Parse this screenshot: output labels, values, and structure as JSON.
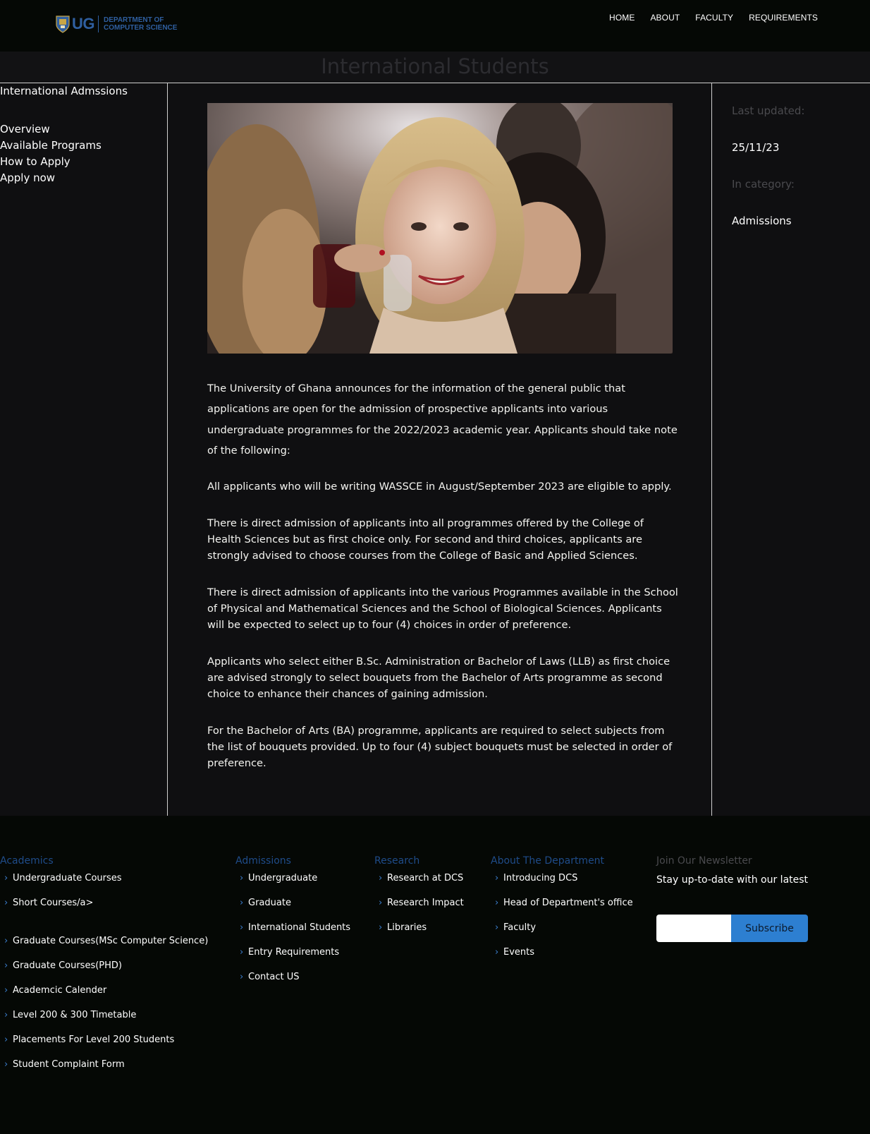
{
  "header": {
    "logo_abbrev": "UG",
    "logo_dept_line1": "DEPARTMENT OF",
    "logo_dept_line2": "COMPUTER SCIENCE",
    "nav": [
      {
        "label": "HOME"
      },
      {
        "label": "ABOUT"
      },
      {
        "label": "FACULTY"
      },
      {
        "label": "REQUIREMENTS"
      }
    ]
  },
  "page_title": "International Students",
  "sidebar": {
    "title": "International Admssions",
    "items": [
      {
        "label": "Overview"
      },
      {
        "label": "Available Programs"
      },
      {
        "label": "How to Apply"
      },
      {
        "label": "Apply now"
      }
    ]
  },
  "meta": {
    "updated_label": "Last updated:",
    "updated_value": "25/11/23",
    "category_label": "In category:",
    "category_value": "Admissions"
  },
  "content": {
    "paragraphs": [
      "The University of Ghana announces for the information of the general public that applications are open for the admission of prospective applicants into various undergraduate programmes for the 2022/2023 academic year. Applicants should take note of the following:",
      "All applicants who will be writing WASSCE in August/September 2023 are eligible to apply.",
      "There is direct admission of applicants into all programmes offered by the College of Health Sciences but as first choice only. For second and third choices, applicants are strongly advised to choose courses from the College of Basic and Applied Sciences.",
      "There is direct admission of applicants into the various Programmes available in the School of Physical and Mathematical Sciences and the School of Biological Sciences. Applicants will be expected to select up to four (4) choices in order of preference.",
      "Applicants who select either B.Sc. Administration or Bachelor of Laws (LLB) as first choice are advised strongly to select bouquets from the Bachelor of Arts programme as second choice to enhance their chances of gaining admission.",
      "For the Bachelor of Arts (BA) programme, applicants are required to select subjects from the list of bouquets provided. Up to four (4) subject bouquets must be selected in order of preference."
    ]
  },
  "footer": {
    "academics": {
      "title": "Academics",
      "items": [
        "Undergraduate Courses",
        "Short Courses/a>",
        "Graduate Courses(MSc Computer Science)",
        "Graduate Courses(PHD)",
        "Academcic Calender",
        "Level 200 & 300 Timetable",
        "Placements For Level 200 Students",
        "Student Complaint Form"
      ]
    },
    "admissions": {
      "title": "Admissions",
      "items": [
        "Undergraduate",
        "Graduate",
        "International Students",
        "Entry Requirements",
        "Contact US"
      ]
    },
    "research": {
      "title": "Research",
      "items": [
        "Research at DCS",
        "Research Impact",
        "Libraries"
      ]
    },
    "about": {
      "title": "About The Department",
      "items": [
        "Introducing DCS",
        "Head of Department's office",
        "Faculty",
        "Events"
      ]
    },
    "newsletter": {
      "title": "Join Our Newsletter",
      "tagline": "Stay up-to-date with our latest",
      "input_value": "",
      "button_label": "Subscribe"
    },
    "chevron_glyph": "›"
  },
  "colors": {
    "accent": "#2d7fd1",
    "footer_heading": "#1f4c8a",
    "background": "#050805",
    "panel": "#0f0f11"
  }
}
